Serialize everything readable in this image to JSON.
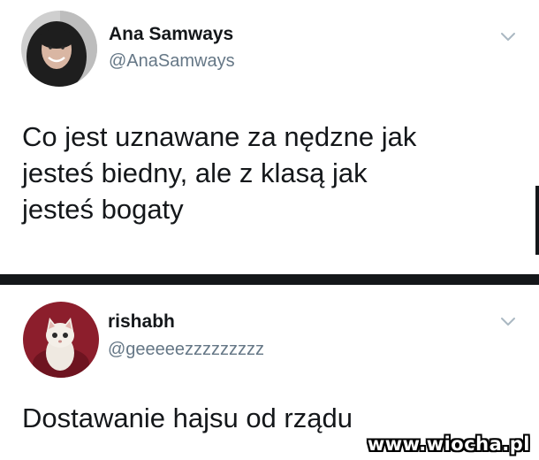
{
  "tweets": [
    {
      "display_name": "Ana Samways",
      "handle": "@AnaSamways",
      "text": "Co jest uznawane za nędzne jak\njesteś biedny, ale z klasą jak\njesteś bogaty",
      "menu_icon": "chevron-down-icon"
    },
    {
      "display_name": "rishabh",
      "handle": "@geeeeezzzzzzzzz",
      "text": "Dostawanie hajsu od rządu",
      "menu_icon": "chevron-down-icon"
    }
  ],
  "watermark": "www.wiocha.pl",
  "colors": {
    "name": "#14171a",
    "handle": "#657786",
    "divider": "#14171a",
    "chevron": "#aab8c2"
  }
}
